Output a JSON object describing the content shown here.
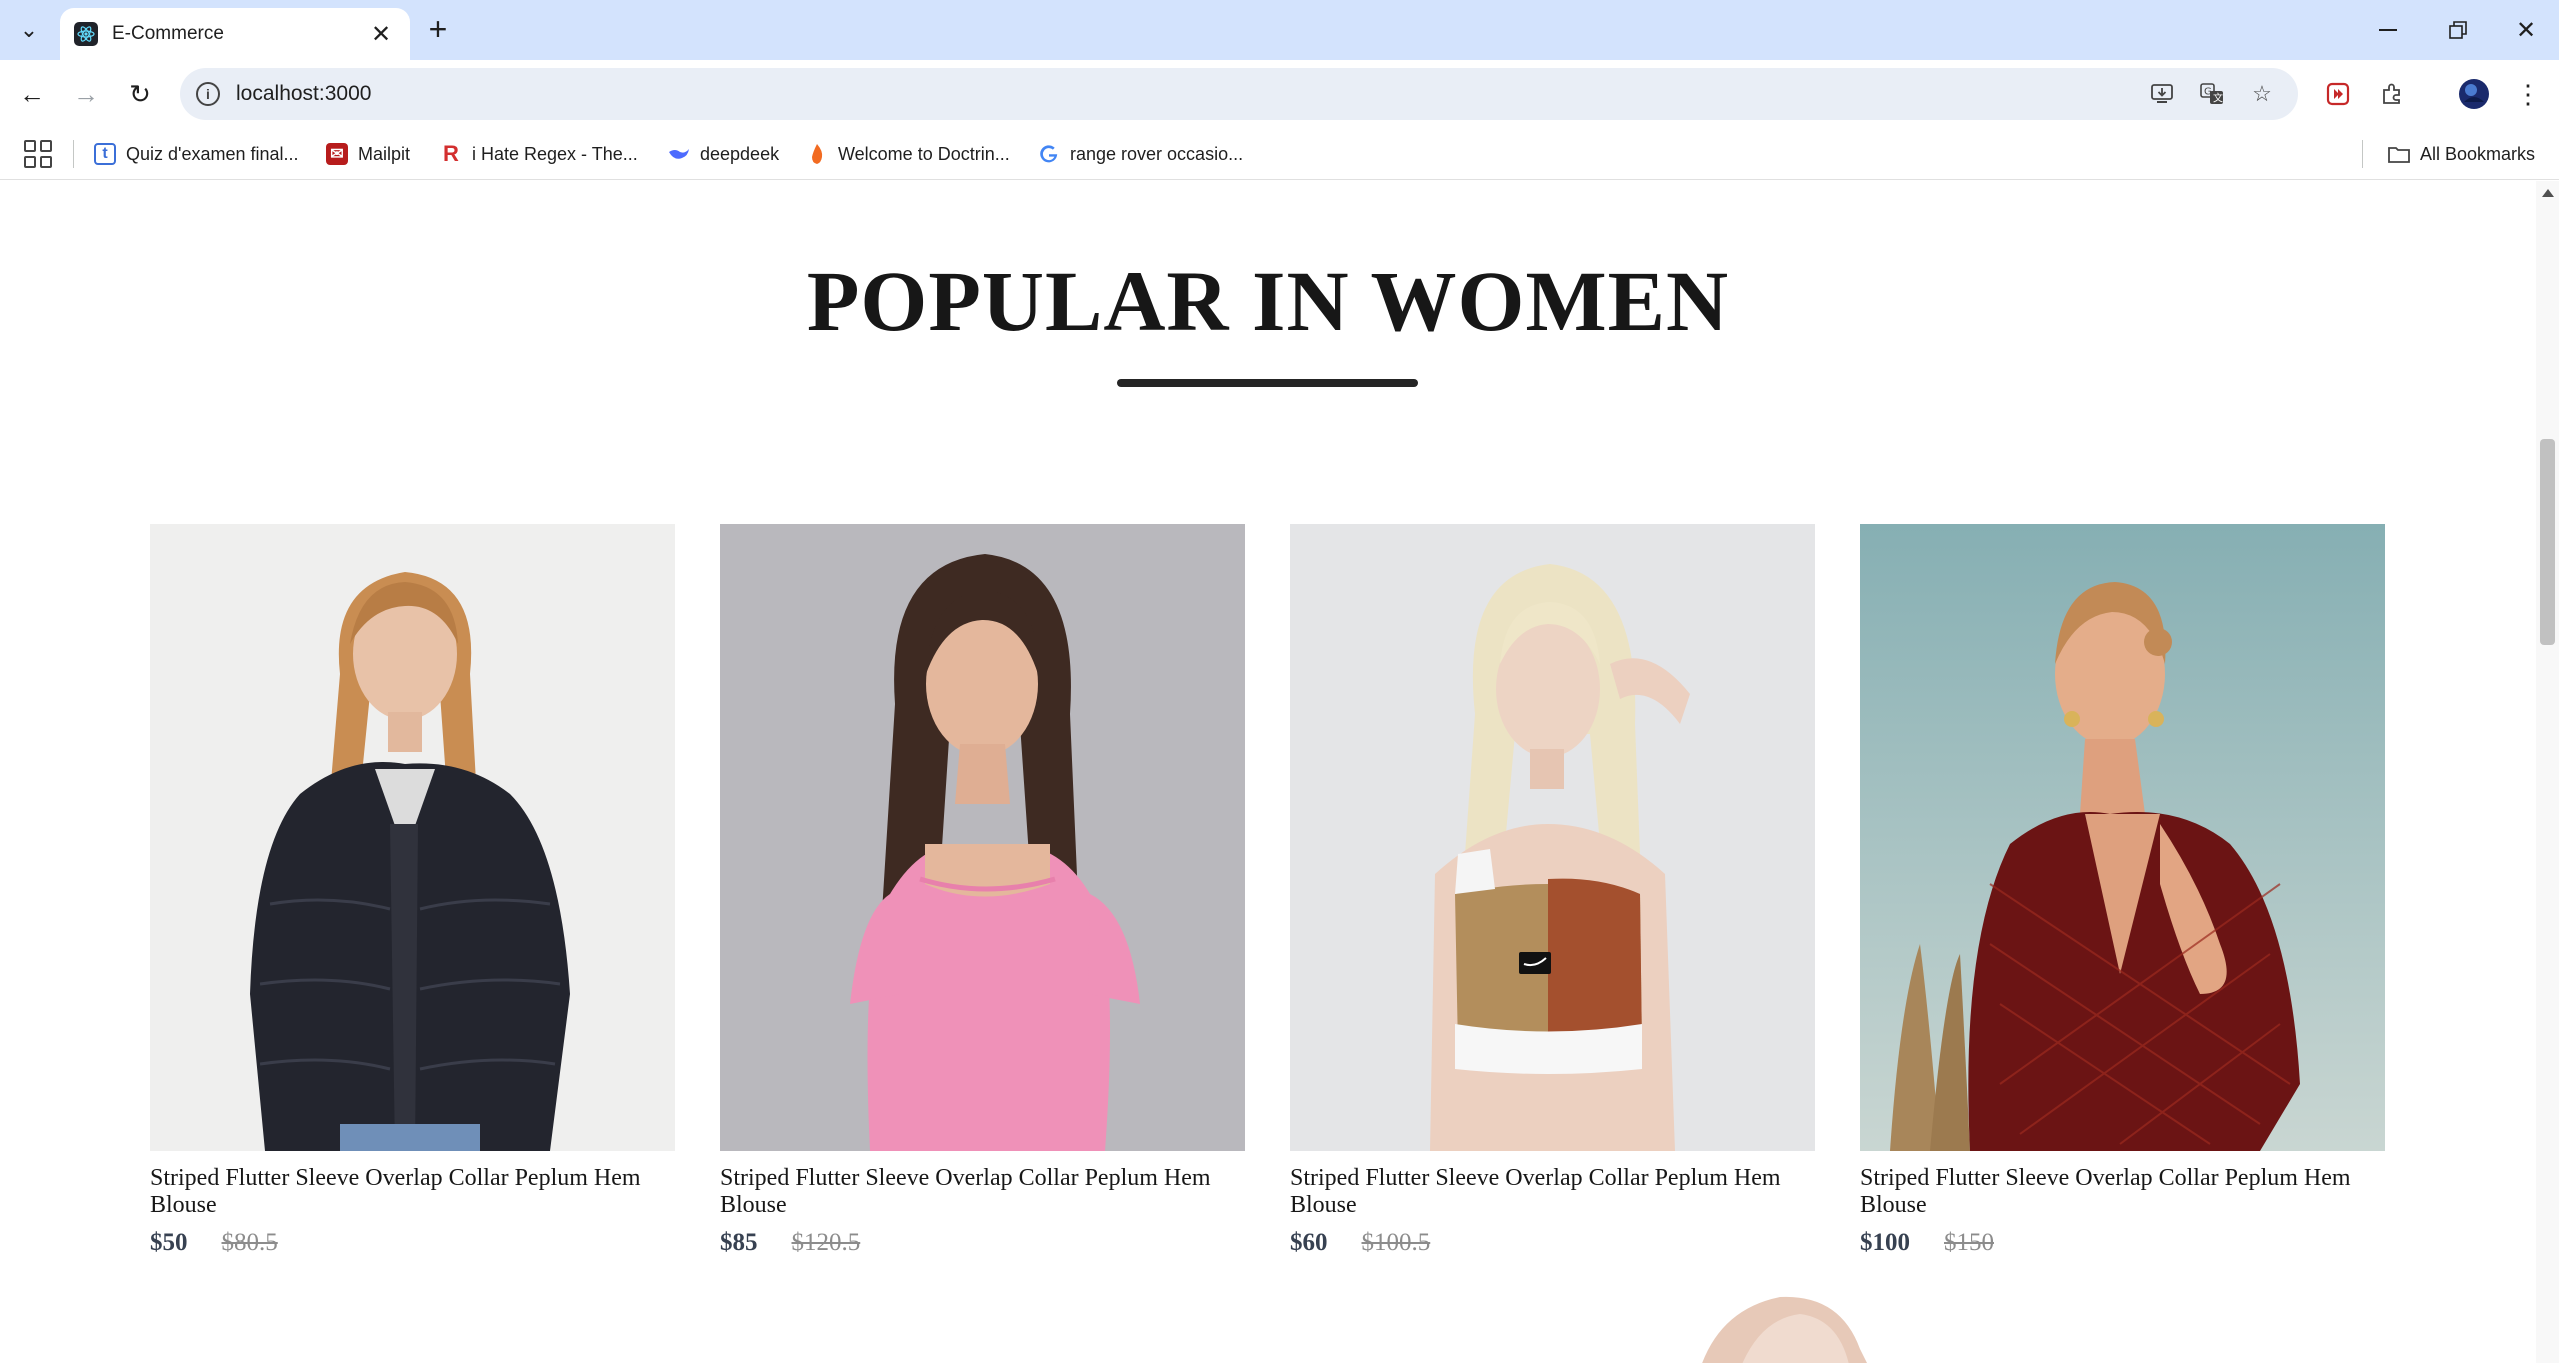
{
  "browser": {
    "tab_title": "E-Commerce",
    "url": "localhost:3000",
    "bookmarks": [
      {
        "label": "Quiz d'examen final...",
        "icon": "quiz-icon"
      },
      {
        "label": "Mailpit",
        "icon": "mailpit-icon"
      },
      {
        "label": "i Hate Regex - The...",
        "icon": "regex-icon"
      },
      {
        "label": "deepdeek",
        "icon": "deepseek-icon"
      },
      {
        "label": "Welcome to Doctrin...",
        "icon": "doctrine-icon"
      },
      {
        "label": "range rover occasio...",
        "icon": "google-icon"
      }
    ],
    "all_bookmarks_label": "All Bookmarks"
  },
  "page": {
    "section_title": "POPULAR IN WOMEN",
    "products": [
      {
        "name": "Striped Flutter Sleeve Overlap Collar Peplum Hem Blouse",
        "new_price": "$50",
        "old_price": "$80.5",
        "image": "black-fur-jacket-photo"
      },
      {
        "name": "Striped Flutter Sleeve Overlap Collar Peplum Hem Blouse",
        "new_price": "$85",
        "old_price": "$120.5",
        "image": "pink-top-photo"
      },
      {
        "name": "Striped Flutter Sleeve Overlap Collar Peplum Hem Blouse",
        "new_price": "$60",
        "old_price": "$100.5",
        "image": "colorblock-crop-top-photo"
      },
      {
        "name": "Striped Flutter Sleeve Overlap Collar Peplum Hem Blouse",
        "new_price": "$100",
        "old_price": "$150",
        "image": "red-blouse-photo"
      }
    ]
  },
  "colors": {
    "tabbar": "#d3e3fd",
    "omnibox": "#e9eef6",
    "title_text": "#171717",
    "price_new": "#374151",
    "price_old": "#8c8c8c"
  }
}
